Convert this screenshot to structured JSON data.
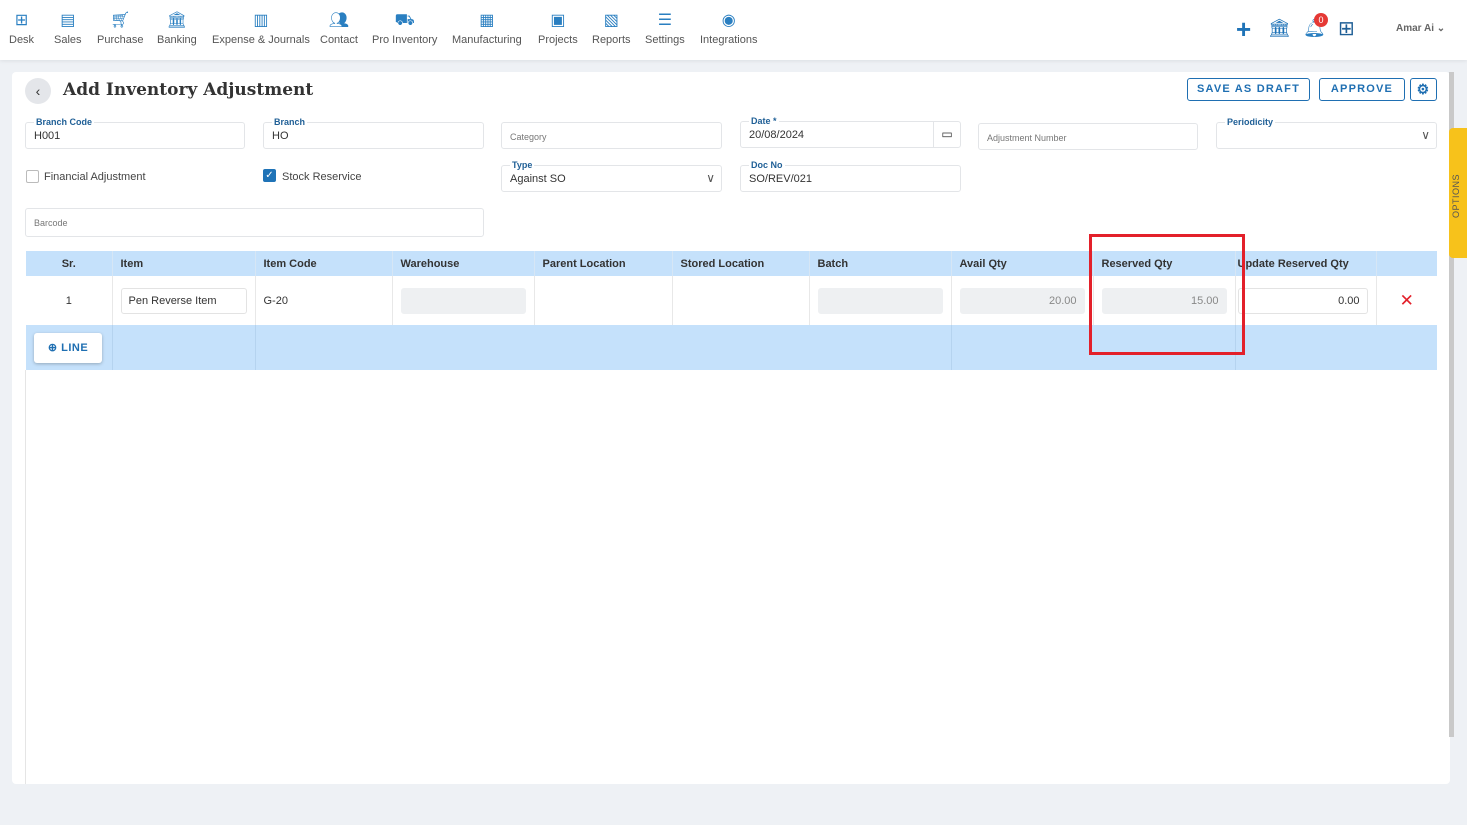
{
  "nav": {
    "items": [
      {
        "label": "Desk",
        "icon": "desk-icon"
      },
      {
        "label": "Sales",
        "icon": "sales-icon"
      },
      {
        "label": "Purchase",
        "icon": "cart-icon"
      },
      {
        "label": "Banking",
        "icon": "bank-icon"
      },
      {
        "label": "Expense & Journals",
        "icon": "journal-icon"
      },
      {
        "label": "Contact",
        "icon": "contact-icon"
      },
      {
        "label": "Pro Inventory",
        "icon": "inventory-icon"
      },
      {
        "label": "Manufacturing",
        "icon": "factory-icon"
      },
      {
        "label": "Projects",
        "icon": "projects-icon"
      },
      {
        "label": "Reports",
        "icon": "reports-icon"
      },
      {
        "label": "Settings",
        "icon": "settings-sliders-icon"
      },
      {
        "label": "Integrations",
        "icon": "integrations-icon"
      }
    ],
    "notification_count": "0",
    "user": "Amar Ai"
  },
  "page": {
    "title": "Add Inventory Adjustment",
    "save_draft": "SAVE AS DRAFT",
    "approve": "APPROVE",
    "options": "OPTIONS"
  },
  "form": {
    "branch_code": {
      "label": "Branch Code",
      "value": "H001"
    },
    "branch": {
      "label": "Branch",
      "value": "HO"
    },
    "category": {
      "placeholder": "Category"
    },
    "date": {
      "label": "Date *",
      "value": "20/08/2024"
    },
    "adjustment_number": {
      "placeholder": "Adjustment Number"
    },
    "periodicity": {
      "label": "Periodicity"
    },
    "financial_adjustment": {
      "label": "Financial Adjustment",
      "checked": false
    },
    "stock_reservice": {
      "label": "Stock Reservice",
      "checked": true
    },
    "type": {
      "label": "Type",
      "value": "Against SO"
    },
    "doc_no": {
      "label": "Doc No",
      "value": "SO/REV/021"
    },
    "barcode": {
      "placeholder": "Barcode"
    }
  },
  "table": {
    "headers": [
      "Sr.",
      "Item",
      "Item Code",
      "Warehouse",
      "Parent Location",
      "Stored Location",
      "Batch",
      "Avail Qty",
      "Reserved Qty",
      "Update Reserved Qty"
    ],
    "rows": [
      {
        "sr": "1",
        "item": "Pen Reverse Item",
        "item_code": "G-20",
        "avail_qty": "20.00",
        "reserved_qty": "15.00",
        "update_reserved_qty": "0.00"
      }
    ],
    "add_line": "LINE"
  },
  "colors": {
    "accent": "#1f6fb2",
    "header_bg": "#c5e1fb",
    "highlight": "#e3202a",
    "options_tab": "#f7c21b"
  }
}
